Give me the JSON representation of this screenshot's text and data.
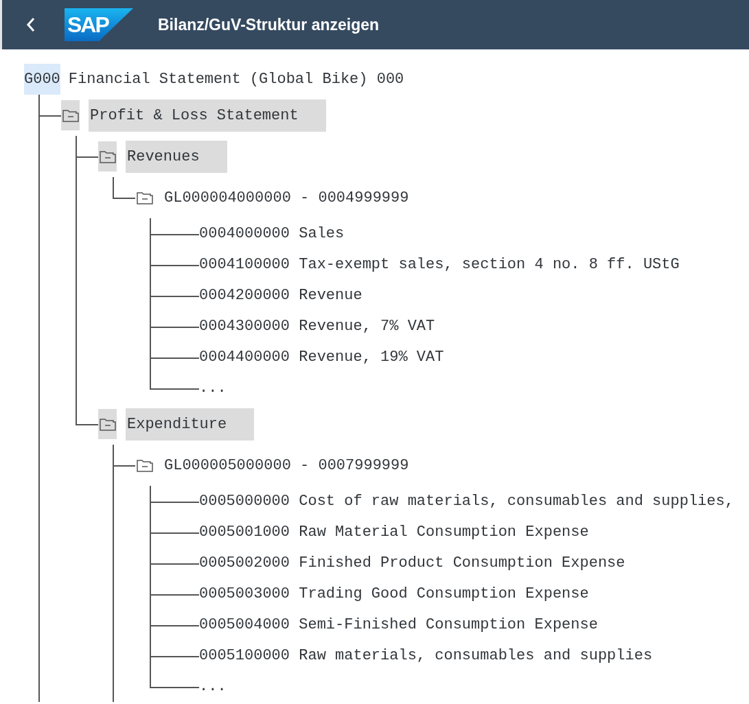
{
  "header": {
    "logo": "SAP",
    "title": "Bilanz/GuV-Struktur anzeigen"
  },
  "tree": {
    "code": "G000",
    "title": "Financial Statement (Global Bike) 000",
    "selected": true,
    "more_below": true,
    "children": [
      {
        "kind": "folder",
        "label": "Profit & Loss Statement",
        "highlighted": true,
        "expanded": true,
        "more_below": false,
        "children": [
          {
            "kind": "folder",
            "label": "Revenues",
            "highlighted": true,
            "expanded": true,
            "more_below": false,
            "children": [
              {
                "kind": "folder",
                "label": "GL000004000000 - 0004999999",
                "highlighted": false,
                "expanded": true,
                "more_below": false,
                "children": [
                  {
                    "kind": "leaf",
                    "label": "0004000000 Sales"
                  },
                  {
                    "kind": "leaf",
                    "label": "0004100000 Tax-exempt sales, section 4 no. 8 ff. UStG"
                  },
                  {
                    "kind": "leaf",
                    "label": "0004200000 Revenue"
                  },
                  {
                    "kind": "leaf",
                    "label": "0004300000 Revenue, 7% VAT"
                  },
                  {
                    "kind": "leaf",
                    "label": "0004400000 Revenue, 19% VAT"
                  },
                  {
                    "kind": "leaf",
                    "label": "..."
                  }
                ]
              }
            ]
          },
          {
            "kind": "folder",
            "label": "Expenditure",
            "highlighted": true,
            "expanded": true,
            "more_below": true,
            "children": [
              {
                "kind": "folder",
                "label": "GL000005000000 - 0007999999",
                "highlighted": false,
                "expanded": true,
                "more_below": false,
                "children": [
                  {
                    "kind": "leaf",
                    "label": "0005000000 Cost of raw materials, consumables and supplies,"
                  },
                  {
                    "kind": "leaf",
                    "label": "0005001000 Raw Material Consumption Expense"
                  },
                  {
                    "kind": "leaf",
                    "label": "0005002000 Finished Product Consumption Expense"
                  },
                  {
                    "kind": "leaf",
                    "label": "0005003000 Trading Good Consumption Expense"
                  },
                  {
                    "kind": "leaf",
                    "label": "0005004000 Semi-Finished Consumption Expense"
                  },
                  {
                    "kind": "leaf",
                    "label": "0005100000 Raw materials, consumables and supplies"
                  },
                  {
                    "kind": "leaf",
                    "label": "..."
                  }
                ]
              }
            ]
          }
        ]
      }
    ]
  }
}
